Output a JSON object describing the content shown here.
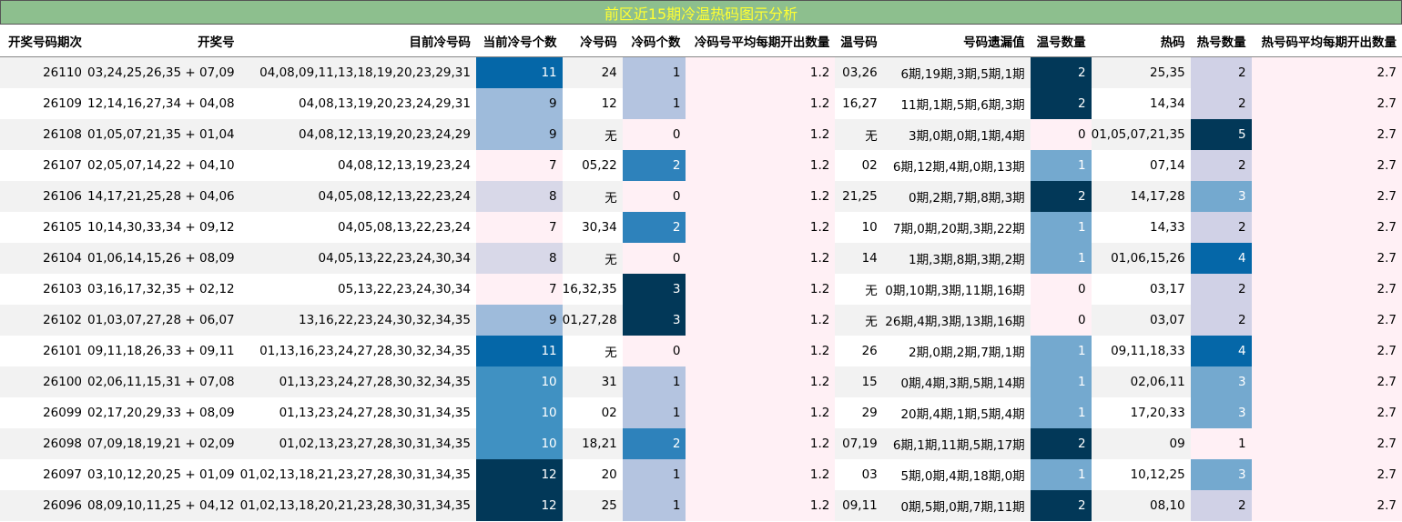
{
  "title": "前区近15期冷温热码图示分析",
  "headers": [
    "开奖号码期次",
    "开奖号",
    "目前冷号码",
    "当前冷号个数",
    "冷号码",
    "冷码个数",
    "冷码号平均每期开出数量",
    "温号码",
    "号码遗漏值",
    "温号数量",
    "热码",
    "热号数量",
    "热号码平均每期开出数量"
  ],
  "colors": {
    "title_bg": "#8dbf8e",
    "title_text": "#ffff33",
    "heat_scale": {
      "0": "#fff0f5",
      "1": "#b4c4e0",
      "2": "#2e82bb",
      "3": "#023858"
    },
    "cur_cold_scale": {
      "7": "#fff0f5",
      "8": "#d8d8e8",
      "9": "#9ebbdb",
      "10": "#4091c2",
      "11": "#0567a8",
      "12": "#023858"
    },
    "warm_scale": {
      "0": "#fff0f5",
      "1": "#74a9cf",
      "2": "#023858"
    },
    "hot_scale": {
      "1": "#fff0f5",
      "2": "#d0d1e6",
      "3": "#74a9cf",
      "4": "#0567a8",
      "5": "#023858"
    }
  },
  "rows": [
    {
      "period": "26110",
      "draw": "03,24,25,26,35 + 07,09",
      "cur_cold": "04,08,09,11,13,18,19,20,23,29,31",
      "cur_cold_count": "11",
      "cold": "24",
      "cold_count": "1",
      "cold_avg": "1.2",
      "warm": "03,26",
      "omission": "6期,19期,3期,5期,1期",
      "warm_count": "2",
      "hot": "25,35",
      "hot_count": "2",
      "hot_avg": "2.7"
    },
    {
      "period": "26109",
      "draw": "12,14,16,27,34 + 04,08",
      "cur_cold": "04,08,13,19,20,23,24,29,31",
      "cur_cold_count": "9",
      "cold": "12",
      "cold_count": "1",
      "cold_avg": "1.2",
      "warm": "16,27",
      "omission": "11期,1期,5期,6期,3期",
      "warm_count": "2",
      "hot": "14,34",
      "hot_count": "2",
      "hot_avg": "2.7"
    },
    {
      "period": "26108",
      "draw": "01,05,07,21,35 + 01,04",
      "cur_cold": "04,08,12,13,19,20,23,24,29",
      "cur_cold_count": "9",
      "cold": "无",
      "cold_count": "0",
      "cold_avg": "1.2",
      "warm": "无",
      "omission": "3期,0期,0期,1期,4期",
      "warm_count": "0",
      "hot": "01,05,07,21,35",
      "hot_count": "5",
      "hot_avg": "2.7"
    },
    {
      "period": "26107",
      "draw": "02,05,07,14,22 + 04,10",
      "cur_cold": "04,08,12,13,19,23,24",
      "cur_cold_count": "7",
      "cold": "05,22",
      "cold_count": "2",
      "cold_avg": "1.2",
      "warm": "02",
      "omission": "6期,12期,4期,0期,13期",
      "warm_count": "1",
      "hot": "07,14",
      "hot_count": "2",
      "hot_avg": "2.7"
    },
    {
      "period": "26106",
      "draw": "14,17,21,25,28 + 04,06",
      "cur_cold": "04,05,08,12,13,22,23,24",
      "cur_cold_count": "8",
      "cold": "无",
      "cold_count": "0",
      "cold_avg": "1.2",
      "warm": "21,25",
      "omission": "0期,2期,7期,8期,3期",
      "warm_count": "2",
      "hot": "14,17,28",
      "hot_count": "3",
      "hot_avg": "2.7"
    },
    {
      "period": "26105",
      "draw": "10,14,30,33,34 + 09,12",
      "cur_cold": "04,05,08,13,22,23,24",
      "cur_cold_count": "7",
      "cold": "30,34",
      "cold_count": "2",
      "cold_avg": "1.2",
      "warm": "10",
      "omission": "7期,0期,20期,3期,22期",
      "warm_count": "1",
      "hot": "14,33",
      "hot_count": "2",
      "hot_avg": "2.7"
    },
    {
      "period": "26104",
      "draw": "01,06,14,15,26 + 08,09",
      "cur_cold": "04,05,13,22,23,24,30,34",
      "cur_cold_count": "8",
      "cold": "无",
      "cold_count": "0",
      "cold_avg": "1.2",
      "warm": "14",
      "omission": "1期,3期,8期,3期,2期",
      "warm_count": "1",
      "hot": "01,06,15,26",
      "hot_count": "4",
      "hot_avg": "2.7"
    },
    {
      "period": "26103",
      "draw": "03,16,17,32,35 + 02,12",
      "cur_cold": "05,13,22,23,24,30,34",
      "cur_cold_count": "7",
      "cold": "16,32,35",
      "cold_count": "3",
      "cold_avg": "1.2",
      "warm": "无",
      "omission": "0期,10期,3期,11期,16期",
      "warm_count": "0",
      "hot": "03,17",
      "hot_count": "2",
      "hot_avg": "2.7"
    },
    {
      "period": "26102",
      "draw": "01,03,07,27,28 + 06,07",
      "cur_cold": "13,16,22,23,24,30,32,34,35",
      "cur_cold_count": "9",
      "cold": "01,27,28",
      "cold_count": "3",
      "cold_avg": "1.2",
      "warm": "无",
      "omission": "26期,4期,3期,13期,16期",
      "warm_count": "0",
      "hot": "03,07",
      "hot_count": "2",
      "hot_avg": "2.7"
    },
    {
      "period": "26101",
      "draw": "09,11,18,26,33 + 09,11",
      "cur_cold": "01,13,16,23,24,27,28,30,32,34,35",
      "cur_cold_count": "11",
      "cold": "无",
      "cold_count": "0",
      "cold_avg": "1.2",
      "warm": "26",
      "omission": "2期,0期,2期,7期,1期",
      "warm_count": "1",
      "hot": "09,11,18,33",
      "hot_count": "4",
      "hot_avg": "2.7"
    },
    {
      "period": "26100",
      "draw": "02,06,11,15,31 + 07,08",
      "cur_cold": "01,13,23,24,27,28,30,32,34,35",
      "cur_cold_count": "10",
      "cold": "31",
      "cold_count": "1",
      "cold_avg": "1.2",
      "warm": "15",
      "omission": "0期,4期,3期,5期,14期",
      "warm_count": "1",
      "hot": "02,06,11",
      "hot_count": "3",
      "hot_avg": "2.7"
    },
    {
      "period": "26099",
      "draw": "02,17,20,29,33 + 08,09",
      "cur_cold": "01,13,23,24,27,28,30,31,34,35",
      "cur_cold_count": "10",
      "cold": "02",
      "cold_count": "1",
      "cold_avg": "1.2",
      "warm": "29",
      "omission": "20期,4期,1期,5期,4期",
      "warm_count": "1",
      "hot": "17,20,33",
      "hot_count": "3",
      "hot_avg": "2.7"
    },
    {
      "period": "26098",
      "draw": "07,09,18,19,21 + 02,09",
      "cur_cold": "01,02,13,23,27,28,30,31,34,35",
      "cur_cold_count": "10",
      "cold": "18,21",
      "cold_count": "2",
      "cold_avg": "1.2",
      "warm": "07,19",
      "omission": "6期,1期,11期,5期,17期",
      "warm_count": "2",
      "hot": "09",
      "hot_count": "1",
      "hot_avg": "2.7"
    },
    {
      "period": "26097",
      "draw": "03,10,12,20,25 + 01,09",
      "cur_cold": "01,02,13,18,21,23,27,28,30,31,34,35",
      "cur_cold_count": "12",
      "cold": "20",
      "cold_count": "1",
      "cold_avg": "1.2",
      "warm": "03",
      "omission": "5期,0期,4期,18期,0期",
      "warm_count": "1",
      "hot": "10,12,25",
      "hot_count": "3",
      "hot_avg": "2.7"
    },
    {
      "period": "26096",
      "draw": "08,09,10,11,25 + 04,12",
      "cur_cold": "01,02,13,18,20,21,23,28,30,31,34,35",
      "cur_cold_count": "12",
      "cold": "25",
      "cold_count": "1",
      "cold_avg": "1.2",
      "warm": "09,11",
      "omission": "0期,5期,0期,7期,11期",
      "warm_count": "2",
      "hot": "08,10",
      "hot_count": "2",
      "hot_avg": "2.7"
    }
  ]
}
